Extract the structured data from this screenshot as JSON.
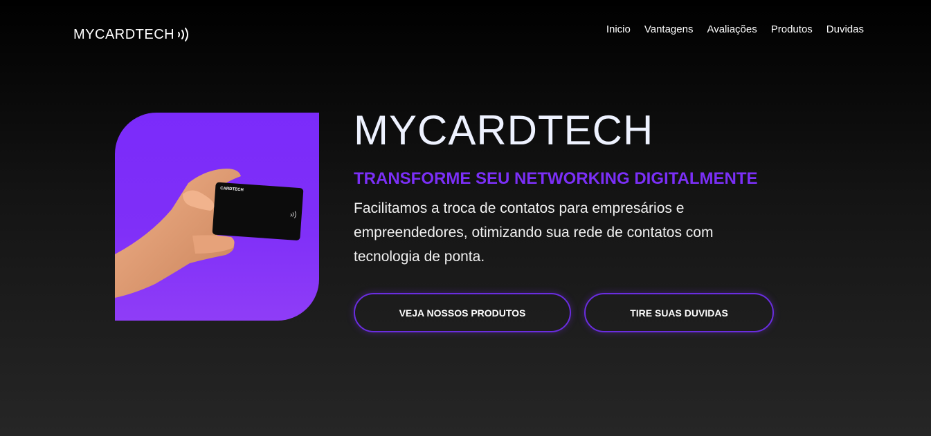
{
  "header": {
    "logo_text": "MYCARDTECH",
    "logo_icon": "nfc-wave-icon"
  },
  "nav": {
    "items": [
      {
        "label": "Inicio"
      },
      {
        "label": "Vantagens"
      },
      {
        "label": "Avaliações"
      },
      {
        "label": "Produtos"
      },
      {
        "label": "Duvidas"
      }
    ]
  },
  "hero": {
    "title": "MYCARDTECH",
    "subtitle": "TRANSFORME SEU NETWORKING DIGITALMENTE",
    "description": "Facilitamos a troca de contatos para empresários e empreendedores, otimizando sua rede de contatos com tecnologia de ponta.",
    "image": {
      "card_label": "CARDTECH",
      "icon": "hand-holding-card-icon"
    },
    "buttons": {
      "products": "VEJA NOSSOS PRODUTOS",
      "faq": "TIRE SUAS DUVIDAS"
    }
  },
  "colors": {
    "accent": "#7b2ff7",
    "background_top": "#000000",
    "background_bottom": "#262626",
    "text": "#ffffff"
  }
}
